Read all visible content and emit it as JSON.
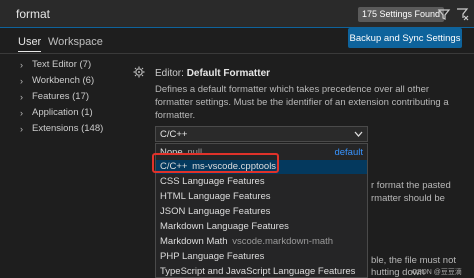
{
  "search": {
    "query": "format",
    "results_badge": "175 Settings Found",
    "filter_icon": "filter-icon",
    "clear_icon": "clear-filter-icon"
  },
  "tabs": {
    "user": "User",
    "workspace": "Workspace"
  },
  "sync_button": {
    "label": "Backup and Sync Settings",
    "color": "#0e639c"
  },
  "toc": [
    {
      "label": "Text Editor (7)"
    },
    {
      "label": "Workbench (6)"
    },
    {
      "label": "Features (17)"
    },
    {
      "label": "Application (1)"
    },
    {
      "label": "Extensions (148)"
    }
  ],
  "setting": {
    "category": "Editor:",
    "name": "Default Formatter",
    "description": "Defines a default formatter which takes precedence over all other formatter settings. Must be the identifier of an extension contributing a formatter.",
    "selected_value": "C/C++"
  },
  "dropdown": {
    "options": [
      {
        "label": "None",
        "desc": "null",
        "right": "default"
      },
      {
        "label": "C/C++",
        "desc": "ms-vscode.cpptools",
        "selected": true
      },
      {
        "label": "CSS Language Features"
      },
      {
        "label": "HTML Language Features"
      },
      {
        "label": "JSON Language Features"
      },
      {
        "label": "Markdown Language Features"
      },
      {
        "label": "Markdown Math",
        "desc": "vscode.markdown-math"
      },
      {
        "label": "PHP Language Features"
      },
      {
        "label": "TypeScript and JavaScript Language Features"
      }
    ]
  },
  "background_text": {
    "line1": "r format the pasted",
    "line2": "rmatter should be",
    "line3": "ble, the file must not",
    "line4": "hutting down"
  },
  "watermark": "CSDN @豆豆滴",
  "colors": {
    "accent": "#0e639c",
    "highlight_border": "#e0322a",
    "link": "#3794ff"
  }
}
